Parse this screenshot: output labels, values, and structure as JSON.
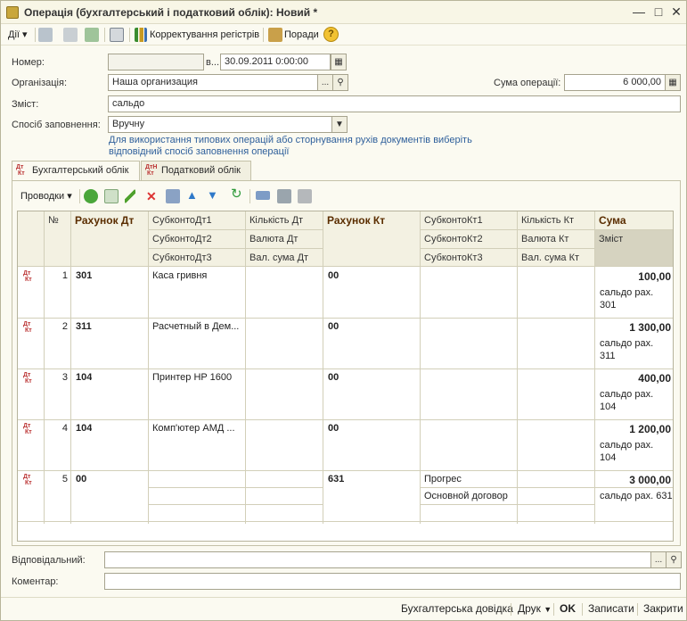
{
  "window": {
    "title": "Операція (бухгалтерський і податковий облік): Новий *"
  },
  "toolbar": {
    "actions_label": "Дії",
    "corrections_label": "Корректування регістрів",
    "tips_label": "Поради",
    "help_label": "?"
  },
  "form": {
    "number_label": "Номер:",
    "number_value": "",
    "date_prefix": "в...",
    "date_value": "30.09.2011  0:00:00",
    "org_label": "Організація:",
    "org_value": "Наша организация",
    "amount_label": "Сума операції:",
    "amount_value": "6 000,00",
    "content_label": "Зміст:",
    "content_value": "сальдо",
    "fill_label": "Спосіб заповнення:",
    "fill_value": "Вручну",
    "hint_line1": "Для використання типових операцій або сторнування рухів документів виберіть",
    "hint_line2": "відповідний спосіб заповнення операції",
    "responsible_label": "Відповідальний:",
    "responsible_value": "",
    "comment_label": "Коментар:",
    "comment_value": ""
  },
  "tabs": [
    {
      "label": "Бухгалтерський облік",
      "icon": "dt-kt-icon"
    },
    {
      "label": "Податковий облік",
      "icon": "dt-kt-tax-icon"
    }
  ],
  "grid_toolbar": {
    "postings_label": "Проводки"
  },
  "grid": {
    "headers": {
      "num": "№",
      "debit": "Рахунок Дт",
      "sub_dt1": "СубконтоДт1",
      "sub_dt2": "СубконтоДт2",
      "sub_dt3": "СубконтоДт3",
      "qty_dt": "Кількість Дт",
      "cur_dt": "Валюта Дт",
      "cursum_dt": "Вал. сума Дт",
      "credit": "Рахунок Кт",
      "sub_kt1": "СубконтоКт1",
      "sub_kt2": "СубконтоКт2",
      "sub_kt3": "СубконтоКт3",
      "qty_kt": "Кількість Кт",
      "cur_kt": "Валюта Кт",
      "cursum_kt": "Вал. сума Кт",
      "sum": "Сума",
      "memo": "Зміст"
    },
    "rows": [
      {
        "n": "1",
        "debit": "301",
        "sub_dt1": "Каса гривня",
        "sub_dt2": "",
        "credit": "00",
        "sub_kt1": "",
        "sub_kt2": "",
        "sum": "100,00",
        "memo1": "сальдо рах.",
        "memo2": "301"
      },
      {
        "n": "2",
        "debit": "311",
        "sub_dt1": "Расчетный в Дем...",
        "sub_dt2": "",
        "credit": "00",
        "sub_kt1": "",
        "sub_kt2": "",
        "sum": "1 300,00",
        "memo1": "сальдо рах.",
        "memo2": "311"
      },
      {
        "n": "3",
        "debit": "104",
        "sub_dt1": "Принтер HP 1600",
        "sub_dt2": "",
        "credit": "00",
        "sub_kt1": "",
        "sub_kt2": "",
        "sum": "400,00",
        "memo1": "сальдо рах.",
        "memo2": "104"
      },
      {
        "n": "4",
        "debit": "104",
        "sub_dt1": "Комп'ютер  АМД ...",
        "sub_dt2": "",
        "credit": "00",
        "sub_kt1": "",
        "sub_kt2": "",
        "sum": "1 200,00",
        "memo1": "сальдо рах.",
        "memo2": "104"
      },
      {
        "n": "5",
        "debit": "00",
        "sub_dt1": "",
        "sub_dt2": "",
        "credit": "631",
        "sub_kt1": "Прогрес",
        "sub_kt2": "Основной договор",
        "sum": "3 000,00",
        "memo1": "сальдо рах. 631",
        "memo2": ""
      }
    ]
  },
  "footer": {
    "reference_label": "Бухгалтерська довідка",
    "print_label": "Друк",
    "ok_label": "OK",
    "save_label": "Записати",
    "close_label": "Закрити"
  },
  "colors": {
    "window_bg": "#fbfaf1",
    "hint_text": "#2e5f9b",
    "header_bold": "#5a2d00",
    "sum_header_bg": "#d6d3c0"
  }
}
